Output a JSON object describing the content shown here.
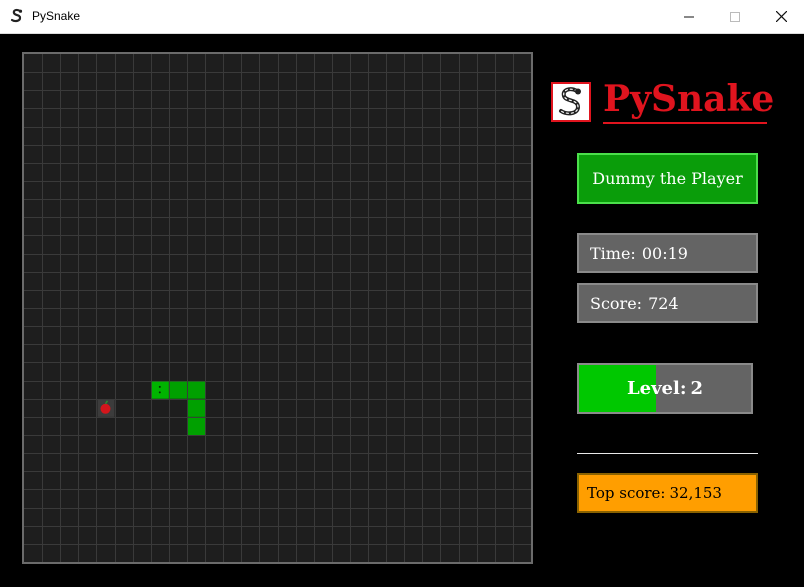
{
  "window": {
    "title": "PySnake",
    "controls": {
      "minimize": "—",
      "maximize": "☐",
      "close": "✕"
    }
  },
  "logo": {
    "text": "PySnake",
    "icon": "snake-icon"
  },
  "player": {
    "name": "Dummy the Player"
  },
  "stats": {
    "time_label": "Time:",
    "time_value": "00:19",
    "score_label": "Score:",
    "score_value": "724"
  },
  "level": {
    "label": "Level:",
    "value": "2",
    "progress_percent": 45
  },
  "top_score": {
    "label": "Top score:",
    "value": "32,153"
  },
  "board": {
    "columns": 28,
    "rows": 28,
    "snake": [
      [
        7,
        18
      ],
      [
        8,
        18
      ],
      [
        9,
        18
      ],
      [
        9,
        19
      ],
      [
        9,
        20
      ]
    ],
    "apple": [
      4,
      19
    ]
  },
  "colors": {
    "brand_red": "#e0141e",
    "snake_green": "#00a000",
    "player_green": "#0a9d0a",
    "level_fill": "#00c800",
    "top_score_orange": "#ff9e00",
    "panel_gray": "#646464"
  }
}
